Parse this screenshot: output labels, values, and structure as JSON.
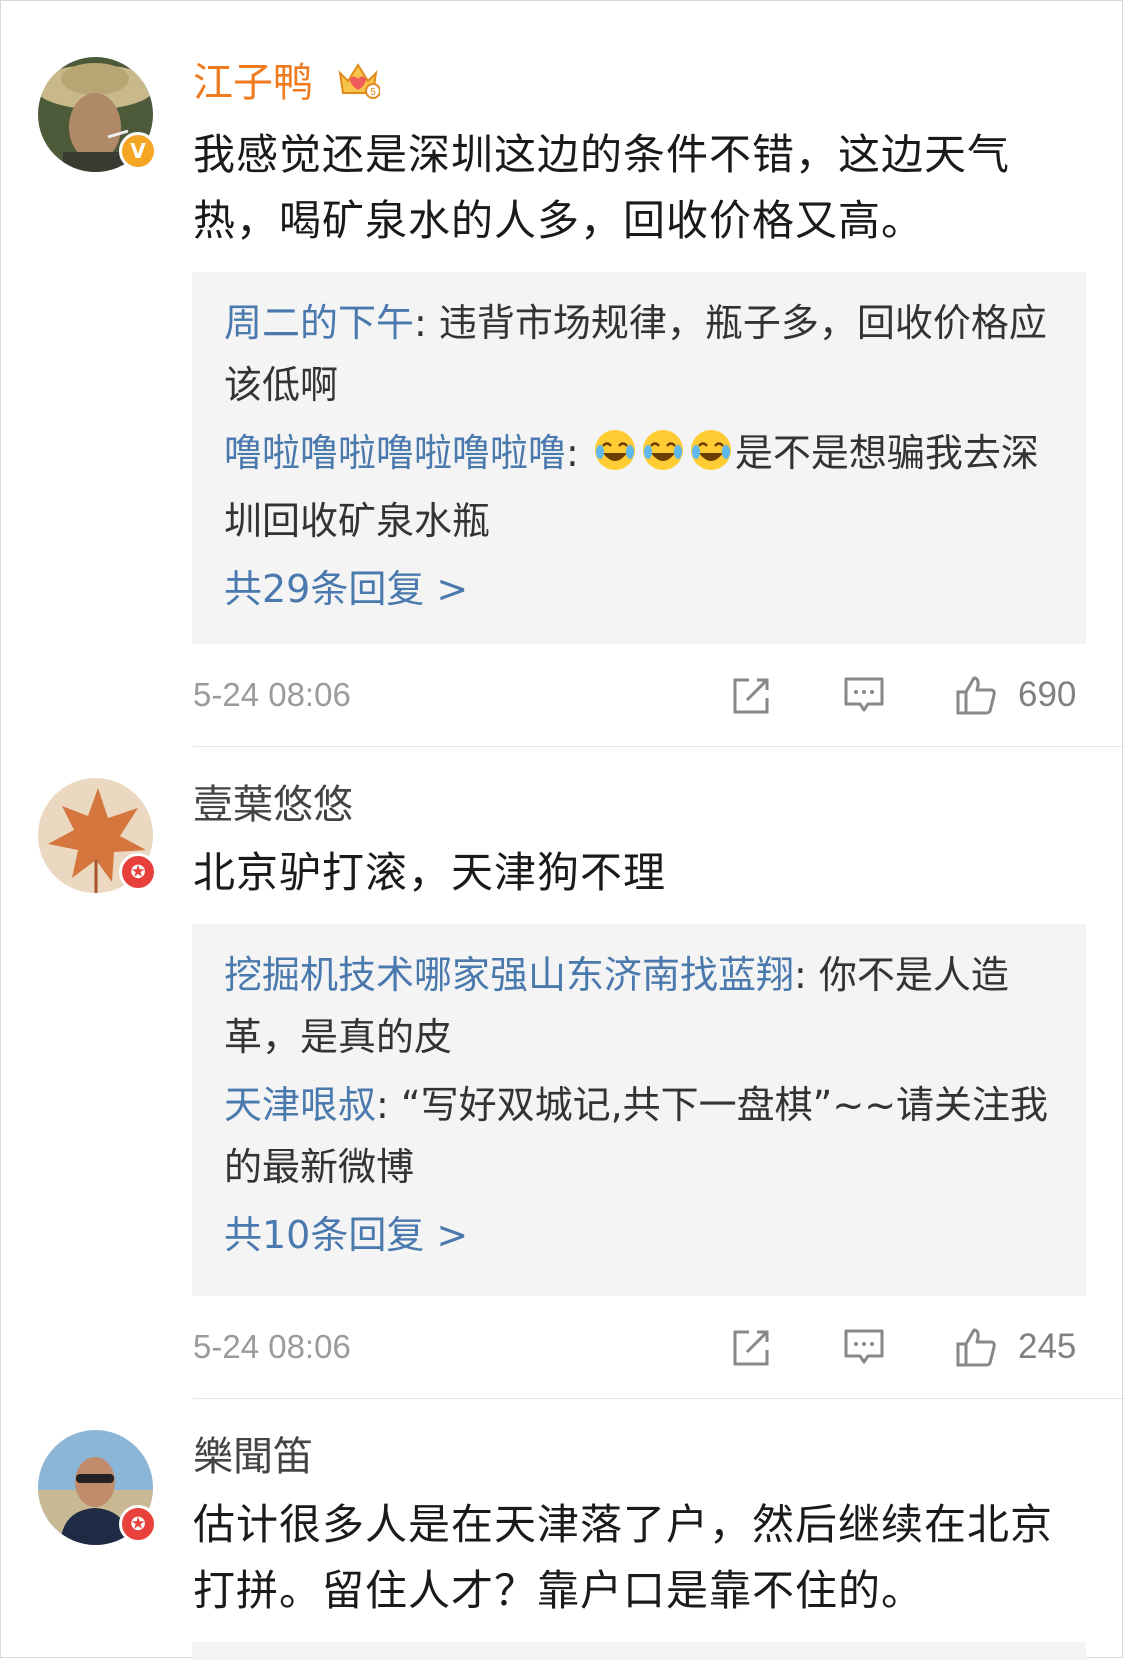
{
  "comments": [
    {
      "username": "江子鸭",
      "text": "我感觉还是深圳这边的条件不错，这边天气热，喝矿泉水的人多，回收价格又高。",
      "replies": [
        {
          "name": "周二的下午",
          "text": ": 违背市场规律，瓶子多，回收价格应该低啊"
        },
        {
          "name": "噜啦噜啦噜啦噜啦噜",
          "text": "是不是想骗我去深圳回收矿泉水瓶",
          "emoji_prefix": ": "
        }
      ],
      "more_replies": "共29条回复 >",
      "time": "5-24 08:06",
      "likes": "690",
      "badge": "V"
    },
    {
      "username": "壹葉悠悠",
      "text": "北京驴打滚，天津狗不理",
      "replies": [
        {
          "name": "挖掘机技术哪家强山东济南找蓝翔",
          "text": ": 你不是人造革，是真的皮"
        },
        {
          "name": "天津哏叔",
          "text": ": “写好双城记,共下一盘棋”~~请关注我的最新微博"
        }
      ],
      "more_replies": "共10条回复 >",
      "time": "5-24 08:06",
      "likes": "245",
      "badge": "✪"
    },
    {
      "username": "樂聞笛",
      "text": "估计很多人是在天津落了户，然后继续在北京打拼。留住人才？靠户口是靠不住的。",
      "badge": "✪"
    }
  ],
  "colors": {
    "vip_name": "#f07a1e",
    "reply_name": "#4a79ad",
    "reply_bg": "#f4f4f4",
    "meta_gray": "#9b9b9b"
  },
  "icons": [
    "share-icon",
    "comment-icon",
    "like-icon",
    "vip-crown-icon",
    "laugh-cry-emoji"
  ]
}
